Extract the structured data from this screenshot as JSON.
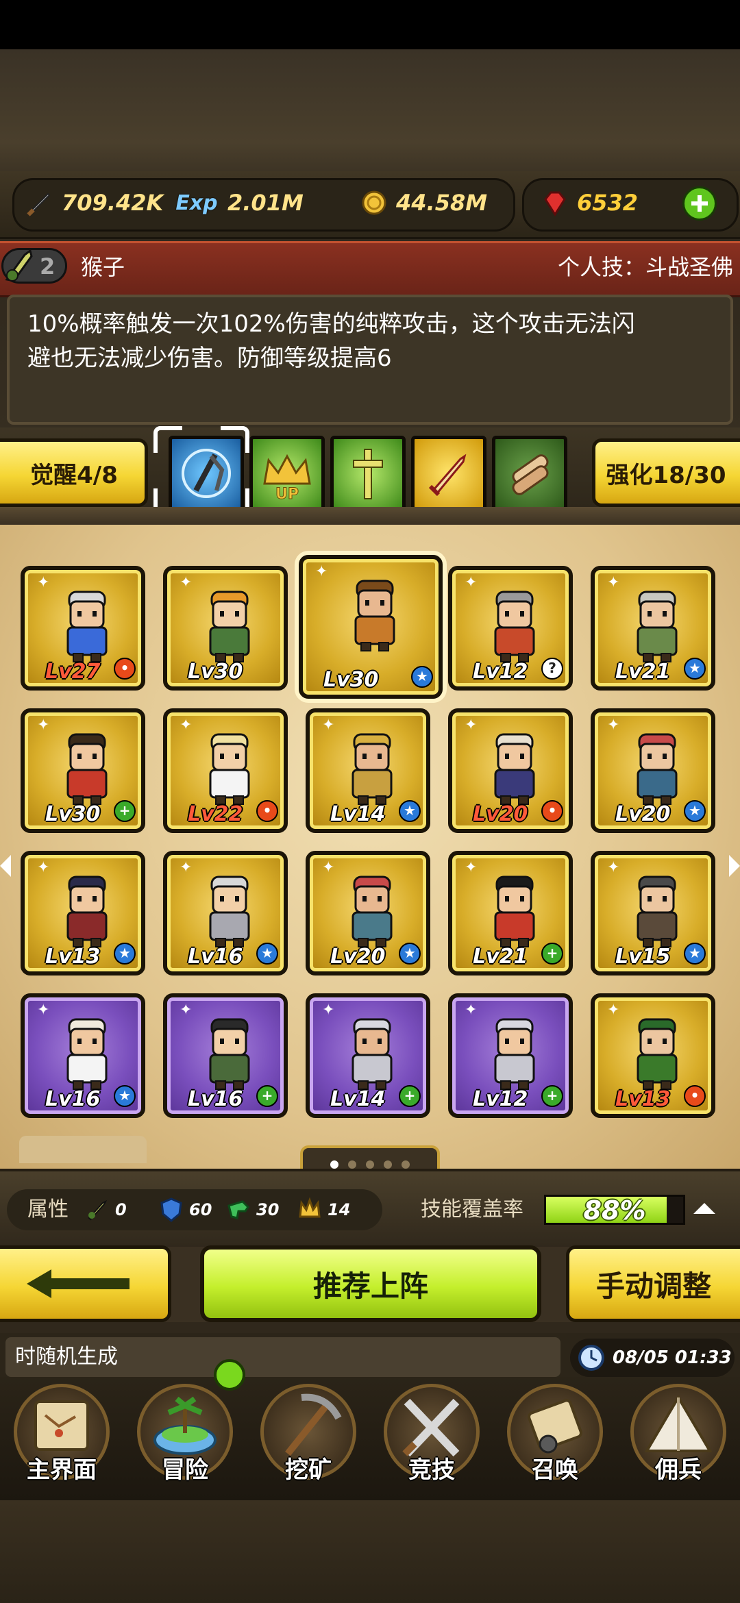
{
  "resources": {
    "attack": "709.42K",
    "exp_label": "Exp",
    "exp": "2.01M",
    "gold": "44.58M",
    "gems": "6532"
  },
  "hero": {
    "level_badge": "2",
    "name": "猴子",
    "skill": "个人技：斗战圣佛",
    "description_line1": "10%概率触发一次102%伤害的纯粹攻击，这个攻击无法闪",
    "description_line2": "避也无法减少伤害。防御等级提高6"
  },
  "awaken_button": "觉醒4/8",
  "enhance_button": "强化18/30",
  "skill_slots": [
    "magic-shield-icon",
    "crown-up-icon",
    "holy-staff-icon",
    "golden-sword-icon",
    "scroll-bundle-icon"
  ],
  "heroes": [
    {
      "level": "Lv27",
      "frame": "gold",
      "mark": "red"
    },
    {
      "level": "Lv30",
      "frame": "gold",
      "mark": "none"
    },
    {
      "level": "Lv30",
      "frame": "gold",
      "mark": "blue",
      "selected": true
    },
    {
      "level": "Lv12",
      "frame": "gold",
      "mark": "question"
    },
    {
      "level": "Lv21",
      "frame": "gold",
      "mark": "blue"
    },
    {
      "level": "Lv30",
      "frame": "gold",
      "mark": "green"
    },
    {
      "level": "Lv22",
      "frame": "gold",
      "mark": "red"
    },
    {
      "level": "Lv14",
      "frame": "gold",
      "mark": "blue"
    },
    {
      "level": "Lv20",
      "frame": "gold",
      "mark": "red"
    },
    {
      "level": "Lv20",
      "frame": "gold",
      "mark": "blue"
    },
    {
      "level": "Lv13",
      "frame": "gold",
      "mark": "blue"
    },
    {
      "level": "Lv16",
      "frame": "gold",
      "mark": "blue"
    },
    {
      "level": "Lv20",
      "frame": "gold",
      "mark": "blue"
    },
    {
      "level": "Lv21",
      "frame": "gold",
      "mark": "green"
    },
    {
      "level": "Lv15",
      "frame": "gold",
      "mark": "blue"
    },
    {
      "level": "Lv16",
      "frame": "purple",
      "mark": "blue"
    },
    {
      "level": "Lv16",
      "frame": "purple",
      "mark": "green"
    },
    {
      "level": "Lv14",
      "frame": "purple",
      "mark": "green"
    },
    {
      "level": "Lv12",
      "frame": "purple",
      "mark": "green"
    },
    {
      "level": "Lv13",
      "frame": "gold",
      "mark": "red"
    }
  ],
  "pager": {
    "pages": 5,
    "current": 0
  },
  "attributes": {
    "label": "属性",
    "sword": "0",
    "shield": "60",
    "boot": "30",
    "crown": "14"
  },
  "coverage": {
    "label": "技能覆盖率",
    "value": "88%",
    "fraction": 0.88
  },
  "actions": {
    "recommend": "推荐上阵",
    "manual": "手动调整"
  },
  "ticker": "时随机生成",
  "clock": "08/05 01:33",
  "nav": [
    {
      "label": "主界面",
      "icon": "map-scroll-icon"
    },
    {
      "label": "冒险",
      "icon": "island-icon"
    },
    {
      "label": "挖矿",
      "icon": "pickaxe-icon"
    },
    {
      "label": "竞技",
      "icon": "crossed-swords-icon"
    },
    {
      "label": "召唤",
      "icon": "summon-scroll-icon"
    },
    {
      "label": "佣兵",
      "icon": "tent-icon"
    }
  ],
  "colors": {
    "gold_frame": "#d8ad29",
    "purple_frame": "#7a4fbd",
    "accent_green": "#c4ef2c",
    "hero_bar": "#7a2a1c"
  }
}
